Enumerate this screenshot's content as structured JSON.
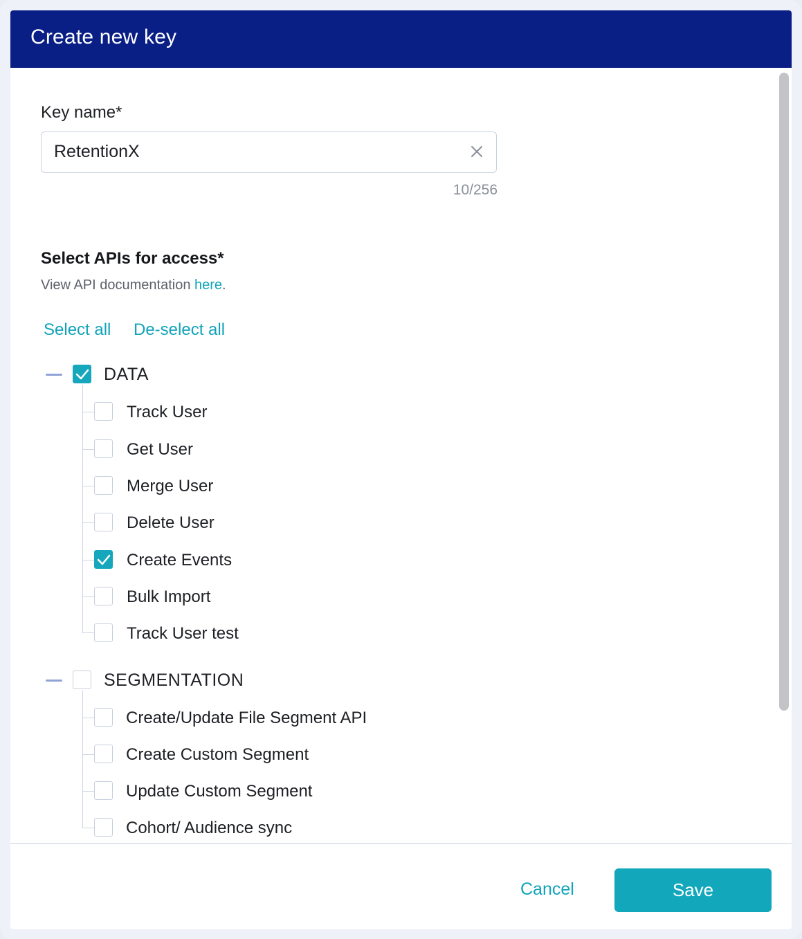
{
  "dialog": {
    "title": "Create new key",
    "key_name_label": "Key name*",
    "key_name_value": "RetentionX",
    "char_counter": "10/256",
    "apis_title": "Select APIs for access*",
    "doc_text": "View API documentation ",
    "doc_link": "here",
    "doc_period": ".",
    "select_all": "Select all",
    "deselect_all": "De-select all"
  },
  "groups": [
    {
      "name": "DATA",
      "checked": true,
      "items": [
        {
          "label": "Track User",
          "checked": false
        },
        {
          "label": "Get User",
          "checked": false
        },
        {
          "label": "Merge User",
          "checked": false
        },
        {
          "label": "Delete User",
          "checked": false
        },
        {
          "label": "Create Events",
          "checked": true
        },
        {
          "label": "Bulk Import",
          "checked": false
        },
        {
          "label": "Track User test",
          "checked": false
        }
      ]
    },
    {
      "name": "SEGMENTATION",
      "checked": false,
      "items": [
        {
          "label": "Create/Update File Segment API",
          "checked": false
        },
        {
          "label": "Create Custom Segment",
          "checked": false
        },
        {
          "label": "Update Custom Segment",
          "checked": false
        },
        {
          "label": "Cohort/ Audience sync",
          "checked": false
        }
      ]
    }
  ],
  "footer": {
    "cancel": "Cancel",
    "save": "Save"
  },
  "colors": {
    "header": "#0a1f85",
    "accent": "#13a7bb",
    "link": "#11a3b9"
  }
}
